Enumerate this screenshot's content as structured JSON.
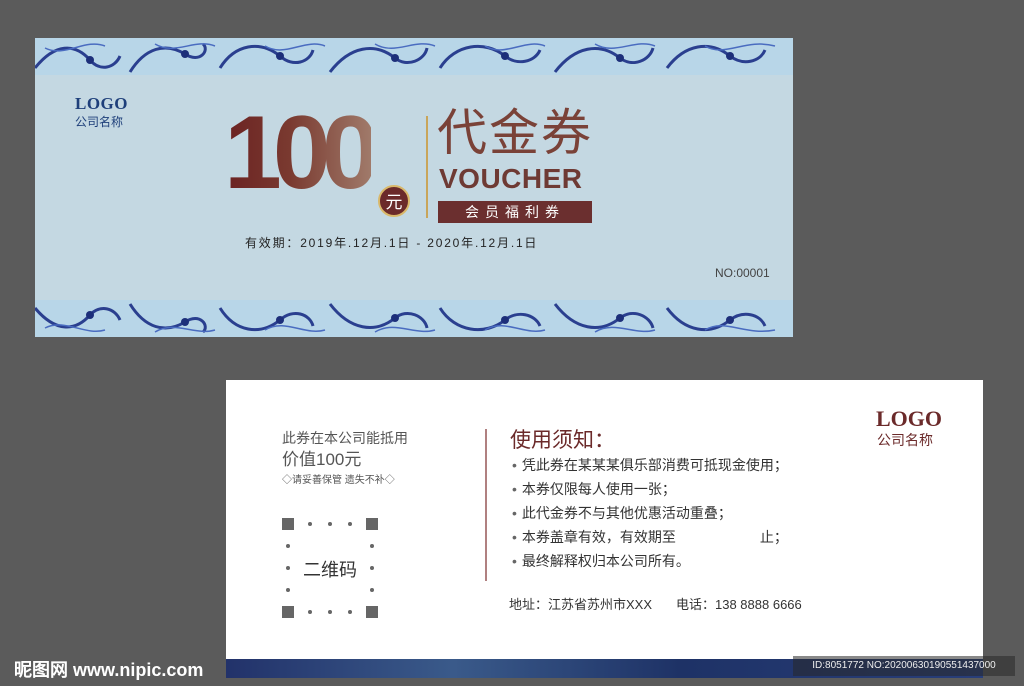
{
  "front": {
    "logo": "LOGO",
    "company": "公司名称",
    "amount": "100",
    "currency": "元",
    "title_cn": "代金券",
    "title_en": "VOUCHER",
    "subtitle": "会员福利券",
    "validity": "有效期：2019年.12月.1日 - 2020年.12月.1日",
    "serial": "NO:00001"
  },
  "back": {
    "logo": "LOGO",
    "company": "公司名称",
    "notice_line1": "此券在本公司能抵用",
    "notice_line2": "价值100元",
    "notice_line3": "◇请妥善保管 遗失不补◇",
    "qr_label": "二维码",
    "rules_title": "使用须知：",
    "rules": [
      "凭此券在某某某俱乐部消费可抵现金使用；",
      "本券仅限每人使用一张；",
      "此代金券不与其他优惠活动重叠；",
      "本券盖章有效，有效期至　　　　　　止；",
      "最终解释权归本公司所有。"
    ],
    "address": "地址：江苏省苏州市XXX",
    "phone": "电话：138 8888 6666"
  },
  "watermark": {
    "site": "昵图网 www.nipic.com",
    "id": "ID:8051772 NO:20200630190551437000"
  },
  "colors": {
    "background": "#5b5b5b",
    "card_front": "#c4d8e2",
    "accent_brown": "#6b2a2a",
    "accent_navy": "#1e3f7a",
    "gold": "#c9a55a"
  }
}
